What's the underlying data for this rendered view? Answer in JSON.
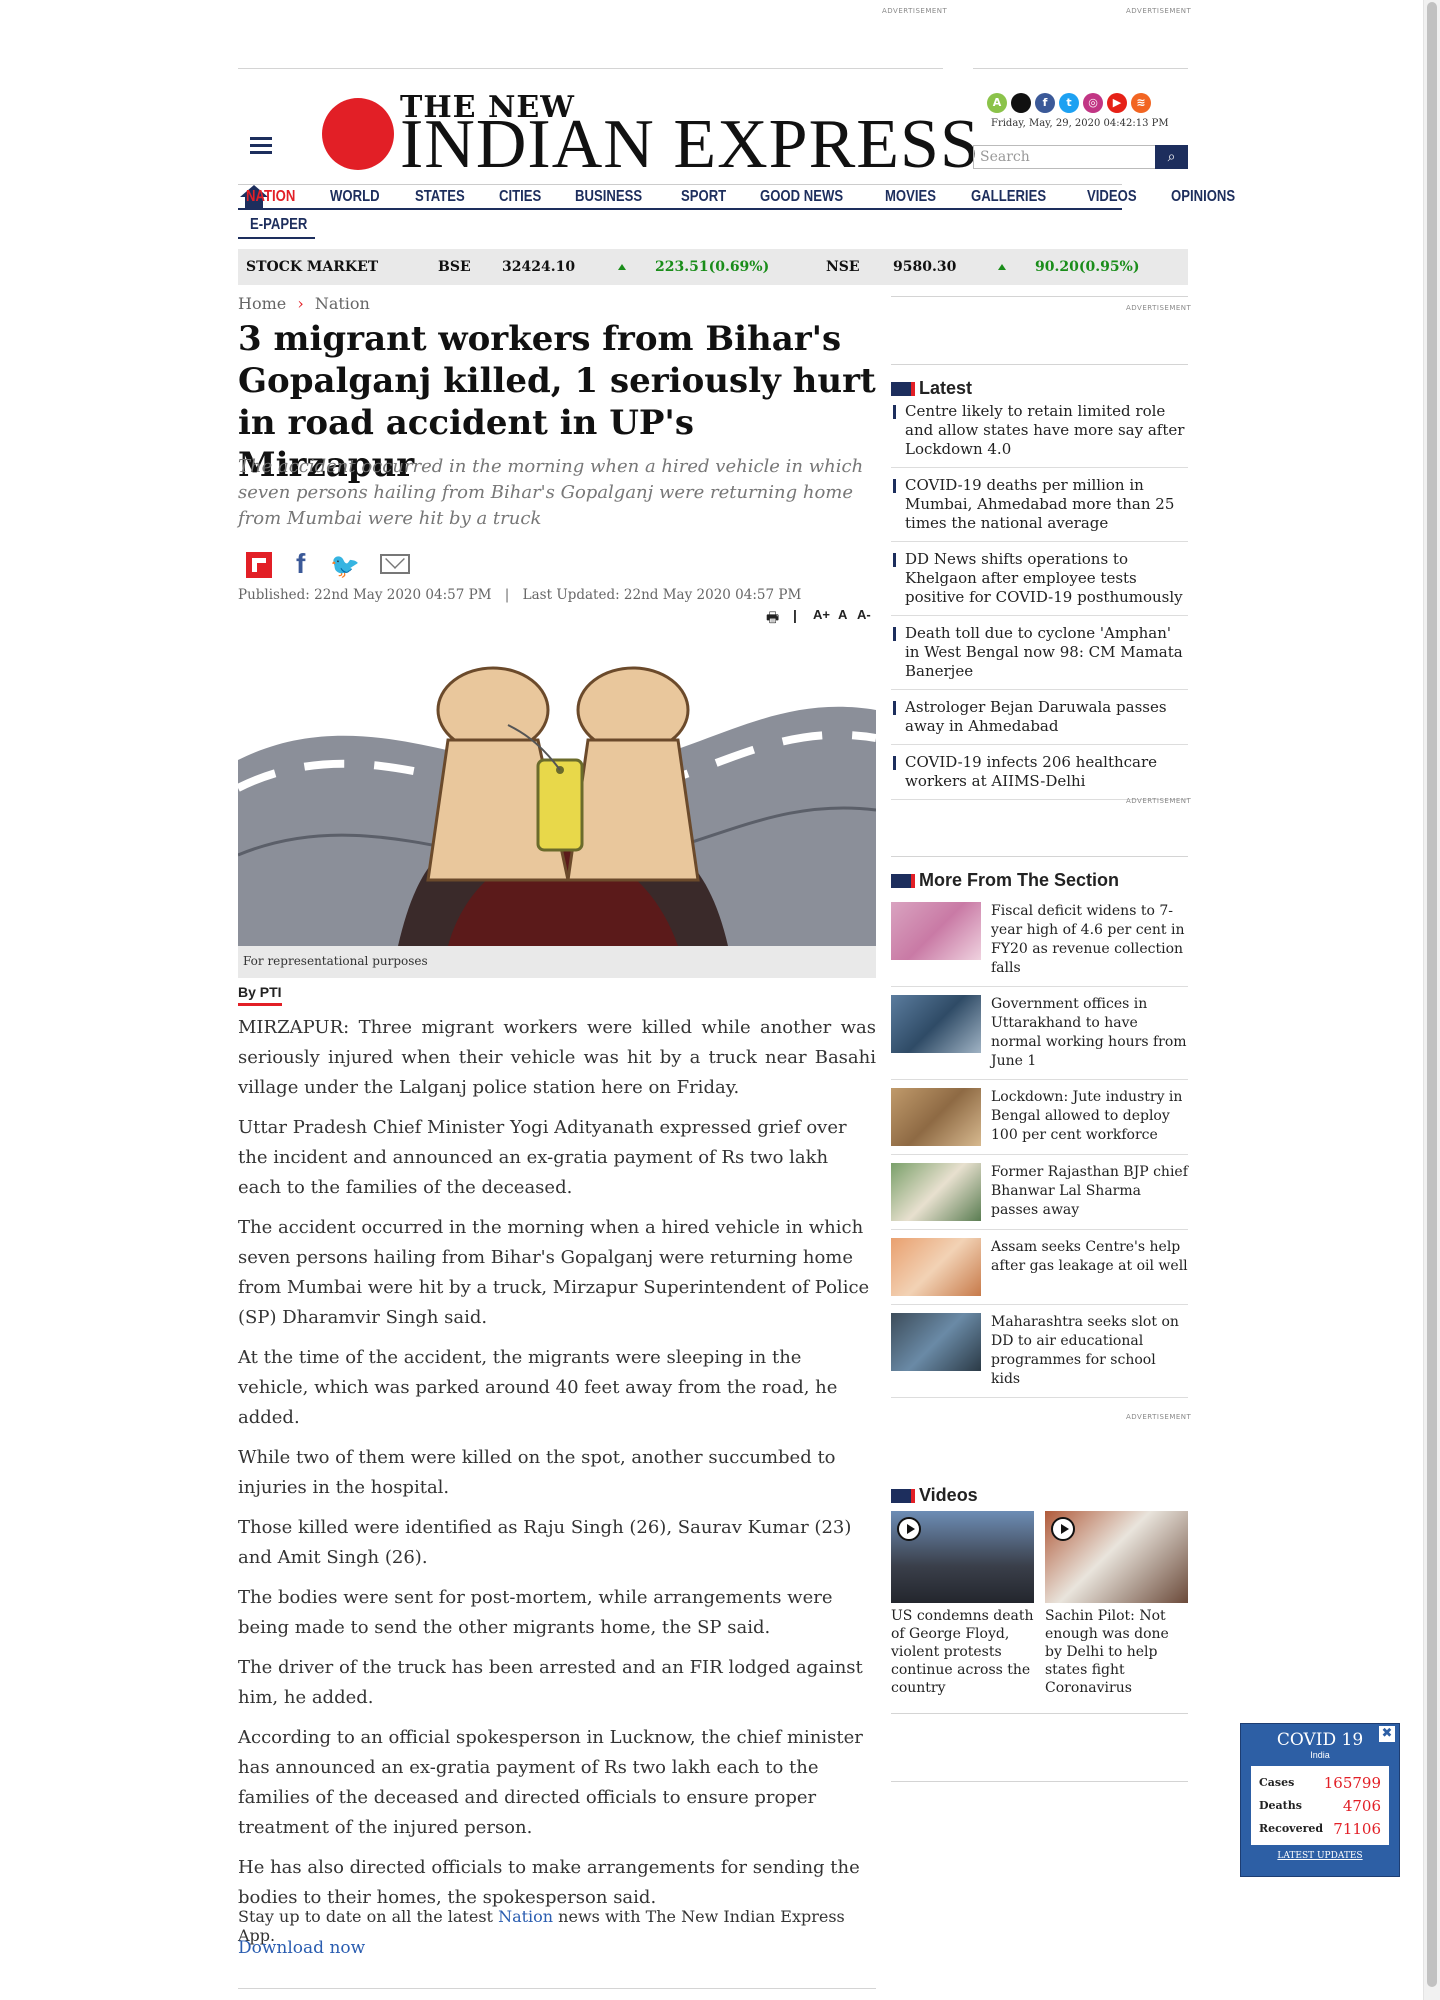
{
  "ads": {
    "label": "ADVERTISEMENT"
  },
  "header": {
    "logo_top": "THE NEW",
    "logo_main": "INDIAN EXPRESS",
    "date": "Friday, May, 29, 2020  04:42:13 PM",
    "search_placeholder": "Search"
  },
  "social_icons": [
    "android-icon",
    "apple-icon",
    "facebook-icon",
    "twitter-icon",
    "instagram-icon",
    "youtube-icon",
    "rss-icon"
  ],
  "nav": {
    "items": [
      "NATION",
      "WORLD",
      "STATES",
      "CITIES",
      "BUSINESS",
      "SPORT",
      "GOOD NEWS",
      "MOVIES",
      "GALLERIES",
      "VIDEOS",
      "OPINIONS"
    ],
    "epaper": "E-PAPER"
  },
  "stock": {
    "label": "STOCK MARKET",
    "bse_label": "BSE",
    "bse_value": "32424.10",
    "bse_change": "223.51(0.69%)",
    "nse_label": "NSE",
    "nse_value": "9580.30",
    "nse_change": "90.20(0.95%)"
  },
  "breadcrumb": {
    "home": "Home",
    "sep": "›",
    "section": "Nation"
  },
  "article": {
    "headline": "3 migrant workers from Bihar's Gopalganj killed, 1 seriously hurt in road accident in UP's Mirzapur",
    "summary": "The accident occurred in the morning when a hired vehicle in which seven persons hailing from Bihar's Gopalganj were returning home from Mumbai were hit by a truck",
    "published": "Published: 22nd May 2020 04:57 PM",
    "meta_sep": "|",
    "updated": "Last Updated: 22nd May 2020 04:57 PM",
    "font_controls": {
      "sep": "|",
      "plus": "A+",
      "normal": "A",
      "minus": "A-"
    },
    "image_caption": "For representational purposes",
    "byline": "By PTI",
    "paragraphs": [
      "MIRZAPUR: Three migrant workers were killed while another was seriously injured when their vehicle was hit by a truck near Basahi village under the Lalganj police station here on Friday.",
      "Uttar Pradesh Chief Minister Yogi Adityanath expressed grief over the incident and announced an ex-gratia payment of Rs two lakh each to the families of the deceased.",
      "The accident occurred in the morning when a hired vehicle in which seven persons hailing from Bihar's Gopalganj were returning home from Mumbai were hit by a truck, Mirzapur Superintendent of Police (SP) Dharamvir Singh said.",
      "At the time of the accident, the migrants were sleeping in the vehicle, which was parked around 40 feet away from the road, he added.",
      "While two of them were killed on the spot, another succumbed to injuries in the hospital.",
      "Those killed were identified as Raju Singh (26), Saurav Kumar (23) and Amit Singh (26).",
      "The bodies were sent for post-mortem, while arrangements were being made to send the other migrants home, the SP said.",
      "The driver of the truck has been arrested and an FIR lodged against him, he added.",
      "According to an official spokesperson in Lucknow, the chief minister has announced an ex-gratia payment of Rs two lakh each to the families of the deceased and directed officials to ensure proper treatment of the injured person.",
      "He has also directed officials to make arrangements for sending the bodies to their homes, the spokesperson said."
    ],
    "app_promo_pre": "Stay up to date on all the latest ",
    "app_promo_link": "Nation",
    "app_promo_post": " news with The New Indian Express App.",
    "download": "Download now"
  },
  "sidebar": {
    "latest_title": "Latest",
    "latest": [
      "Centre likely to retain limited role and allow states have more say after Lockdown 4.0",
      "COVID-19 deaths per million in Mumbai, Ahmedabad more than 25 times the national average",
      "DD News shifts operations to Khelgaon after employee tests positive for COVID-19 posthumously",
      "Death toll due to cyclone 'Amphan' in West Bengal now 98: CM Mamata Banerjee",
      "Astrologer Bejan Daruwala passes away in Ahmedabad",
      "COVID-19 infects 206 healthcare workers at AIIMS-Delhi"
    ],
    "more_title": "More From The Section",
    "more": [
      "Fiscal deficit widens to 7-year high of 4.6 per cent in FY20 as revenue collection falls",
      "Government offices in Uttarakhand to have normal working hours from June 1",
      "Lockdown: Jute industry in Bengal allowed to deploy 100 per cent workforce",
      "Former Rajasthan BJP chief Bhanwar Lal Sharma passes away",
      "Assam seeks Centre's help after gas leakage at oil well",
      "Maharashtra seeks slot on DD to air educational programmes for school kids"
    ],
    "videos_title": "Videos",
    "videos": [
      "US condemns death of George Floyd, violent protests continue across the country",
      "Sachin Pilot: Not enough was done by Delhi to help states fight Coronavirus"
    ]
  },
  "covid": {
    "title": "COVID 19",
    "region": "India",
    "cases_label": "Cases",
    "cases": "165799",
    "deaths_label": "Deaths",
    "deaths": "4706",
    "recovered_label": "Recovered",
    "recovered": "71106",
    "updates": "LATEST UPDATES",
    "close": "✖"
  },
  "colors": {
    "brand_navy": "#1d2e5d",
    "brand_red": "#e21f26",
    "up_green": "#1a8d1a",
    "link_blue": "#2a5db0"
  }
}
